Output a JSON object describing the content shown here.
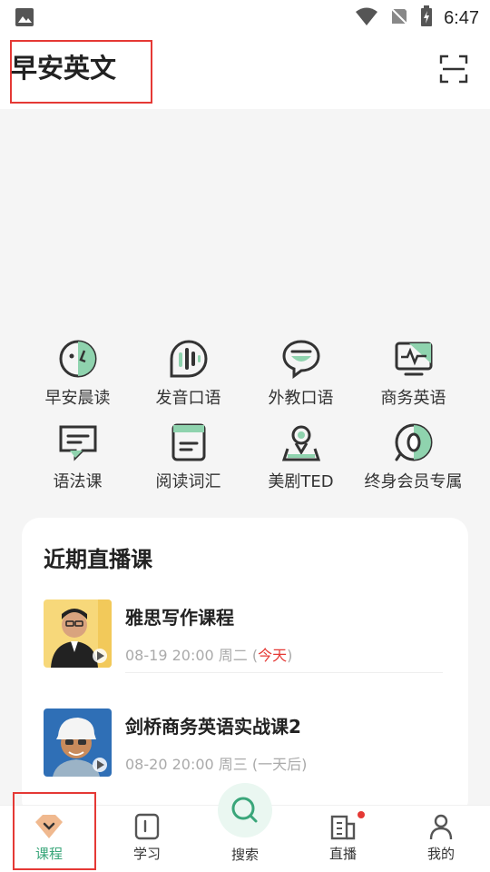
{
  "status_bar": {
    "time": "6:47"
  },
  "header": {
    "title": "早安英文"
  },
  "categories": [
    {
      "label": "早安晨读",
      "icon": "face-icon"
    },
    {
      "label": "发音口语",
      "icon": "soundwave-icon"
    },
    {
      "label": "外教口语",
      "icon": "chat-bubble-icon"
    },
    {
      "label": "商务英语",
      "icon": "monitor-icon"
    },
    {
      "label": "语法课",
      "icon": "message-icon"
    },
    {
      "label": "阅读词汇",
      "icon": "book-icon"
    },
    {
      "label": "美剧TED",
      "icon": "location-pin-icon"
    },
    {
      "label": "终身会员专属",
      "icon": "membership-icon"
    }
  ],
  "live": {
    "title": "近期直播课",
    "courses": [
      {
        "title": "雅思写作课程",
        "meta": "08-19 20:00 周二 (",
        "tag": "今天",
        "meta_end": ")"
      },
      {
        "title": "剑桥商务英语实战课2",
        "meta": "08-20 20:00 周三 (一天后)",
        "tag": "",
        "meta_end": ""
      }
    ]
  },
  "nav": {
    "courses": "课程",
    "study": "学习",
    "search": "搜索",
    "live": "直播",
    "mine": "我的"
  },
  "colors": {
    "accent": "#3aa67a",
    "highlight": "#e53935",
    "icon_fill": "#8fd3ae"
  }
}
